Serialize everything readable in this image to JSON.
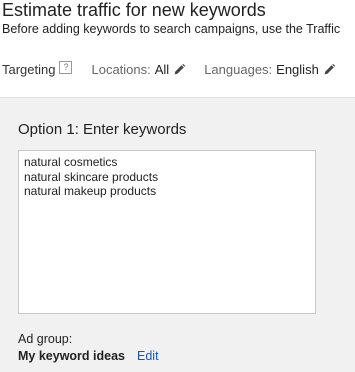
{
  "header": {
    "title": "Estimate traffic for new keywords",
    "subtitle": "Before adding keywords to search campaigns, use the Traffic"
  },
  "targeting": {
    "label": "Targeting",
    "help_glyph": "?",
    "locations_label": "Locations:",
    "locations_value": "All",
    "languages_label": "Languages:",
    "languages_value": "English"
  },
  "option1": {
    "title": "Option 1: Enter keywords",
    "keywords_text": "natural cosmetics\nnatural skincare products\nnatural makeup products"
  },
  "ad_group": {
    "label": "Ad group:",
    "name": "My keyword ideas",
    "edit_label": "Edit"
  },
  "colors": {
    "link": "#1155cc",
    "panel_background": "#f1f1f1",
    "text": "#222222"
  },
  "icons": [
    "help-icon",
    "pencil-icon"
  ]
}
